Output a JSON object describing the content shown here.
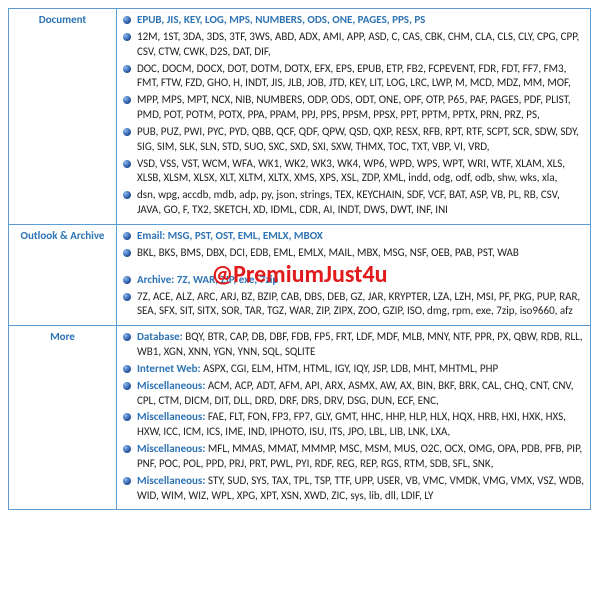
{
  "watermark": "@PremiumJust4u",
  "sections": [
    {
      "label": "Document",
      "items": [
        {
          "head": "EPUB, JIS, KEY, LOG, MPS, NUMBERS, ODS, ONE, PAGES, PPS, PS",
          "body": ""
        },
        {
          "head": "",
          "body": "12M, 1ST, 3DA, 3DS, 3TF, 3WS, ABD, ADX, AMI, APP, ASD, C, CAS, CBK, CHM, CLA, CLS, CLY, CPG, CPP, CSV, CTW, CWK, D2S, DAT, DIF,"
        },
        {
          "head": "",
          "body": "DOC, DOCM, DOCX, DOT, DOTM, DOTX, EFX, EPS, EPUB, ETP, FB2, FCPEVENT, FDR, FDT, FF7, FM3, FMT, FTW, FZD, GHO, H, INDT, JIS, JLB, JOB, JTD, KEY, LIT, LOG, LRC, LWP, M, MCD, MDZ, MM, MOF,"
        },
        {
          "head": "",
          "body": "MPP, MPS, MPT, NCX, NIB, NUMBERS, ODP, ODS, ODT, ONE, OPF, OTP, P65, PAF, PAGES, PDF, PLIST, PMD, POT, POTM, POTX, PPA, PPAM, PPJ, PPS, PPSM, PPSX, PPT, PPTM, PPTX, PRN, PRZ, PS,"
        },
        {
          "head": "",
          "body": "PUB, PUZ, PWI, PYC, PYD, QBB, QCF, QDF, QPW, QSD, QXP, RESX, RFB, RPT, RTF, SCPT, SCR, SDW, SDY, SIG, SIM, SLK, SLN, STD, SUO, SXC, SXD, SXI, SXW, THMX, TOC, TXT, VBP, VI, VRD,"
        },
        {
          "head": "",
          "body": "VSD, VSS, VST, WCM, WFA, WK1, WK2, WK3, WK4, WP6, WPD, WPS, WPT, WRI, WTF, XLAM, XLS, XLSB, XLSM, XLSX, XLT, XLTM, XLTX, XMS, XPS, XSL, ZDP, XML, indd, odg, odf, odb, shw, wks, xla,"
        },
        {
          "head": "",
          "body": "dsn, wpg, accdb, mdb, adp, py, json, strings, TEX, KEYCHAIN, SDF, VCF, BAT, ASP, VB, PL, RB, CSV, JAVA, GO, F, TX2, SKETCH, XD, IDML, CDR, AI, INDT, DWS, DWT, INF, INI"
        }
      ]
    },
    {
      "label": "Outlook & Archive",
      "items": [
        {
          "head": "Email: MSG, PST, OST, EML, EMLX, MBOX",
          "body": ""
        },
        {
          "head": "",
          "body": "BKL, BKS, BMS, DBX, DCI, EDB, EML, EMLX, MAIL, MBX, MSG, NSF, OEB, PAB, PST, WAB"
        },
        {
          "spacer": true
        },
        {
          "head": "Archive: 7Z, WAR, ZIP, exe, 7zip",
          "body": ""
        },
        {
          "head": "",
          "body": "7Z, ACE, ALZ, ARC, ARJ, BZ, BZIP, CAB, DBS, DEB, GZ, JAR, KRYPTER, LZA, LZH, MSI, PF, PKG, PUP, RAR, SEA, SFX, SIT, SITX, SOR, TAR, TGZ, WAR, ZIP, ZIPX, ZOO, GZIP, ISO, dmg, rpm, exe, 7zip, iso9660, afz"
        }
      ]
    },
    {
      "label": "More",
      "items": [
        {
          "head": "Database: ",
          "body": "BQY, BTR, CAP, DB, DBF, FDB, FP5, FRT, LDF, MDF, MLB, MNY, NTF, PPR, PX, QBW, RDB, RLL, WB1, XGN, XNN, YGN, YNN, SQL, SQLITE"
        },
        {
          "head": "Internet Web: ",
          "body": "ASPX, CGI, ELM, HTM, HTML, IGY, IQY, JSP, LDB, MHT, MHTML, PHP"
        },
        {
          "head": "Miscellaneous: ",
          "body": "ACM, ACP, ADT, AFM, API, ARX, ASMX, AW, AX, BIN, BKF, BRK, CAL, CHQ, CNT, CNV, CPL, CTM, DICM, DIT, DLL, DRD, DRF, DRS, DRV, DSG, DUN, ECF, ENC,"
        },
        {
          "head": "Miscellaneous: ",
          "body": "FAE, FLT, FON, FP3, FP7, GLY, GMT, HHC, HHP, HLP, HLX, HQX, HRB, HXI, HXK, HXS, HXW, ICC, ICM, ICS, IME, IND, IPHOTO, ISU, ITS, JPO, LBL, LIB, LNK, LXA,"
        },
        {
          "head": "Miscellaneous: ",
          "body": "MFL, MMAS, MMAT, MMMP, MSC, MSM, MUS, O2C, OCX, OMG, OPA, PDB, PFB, PIP, PNF, POC, POL, PPD, PRJ, PRT, PWL, PYI, RDF, REG, REP, RGS, RTM, SDB, SFL, SNK,"
        },
        {
          "head": "Miscellaneous: ",
          "body": "STY, SUD, SYS, TAX, TPL, TSP, TTF, UPP, USER, VB, VMC, VMDK, VMG, VMX, VSZ, WDB, WID, WIM, WIZ, WPL, XPG, XPT, XSN, XWD, ZIC, sys, lib, dll, LDIF, LY"
        }
      ]
    }
  ]
}
